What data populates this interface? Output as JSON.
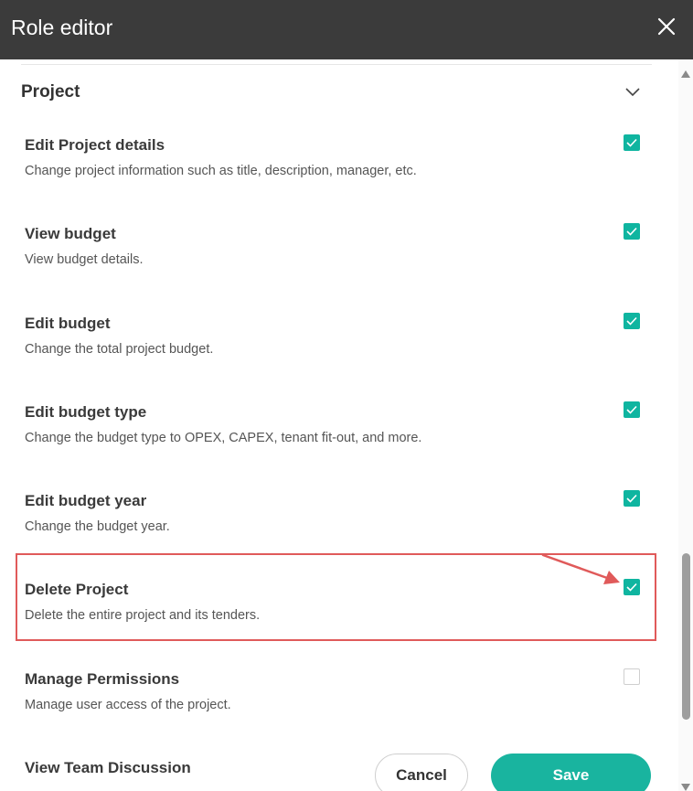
{
  "header": {
    "title": "Role editor"
  },
  "section": {
    "title": "Project"
  },
  "permissions": [
    {
      "title": "Edit Project details",
      "description": "Change project information such as title, description, manager, etc.",
      "checked": true
    },
    {
      "title": "View budget",
      "description": "View budget details.",
      "checked": true
    },
    {
      "title": "Edit budget",
      "description": "Change the total project budget.",
      "checked": true
    },
    {
      "title": "Edit budget type",
      "description": "Change the budget type to OPEX, CAPEX, tenant fit-out, and more.",
      "checked": true
    },
    {
      "title": "Edit budget year",
      "description": "Change the budget year.",
      "checked": true
    },
    {
      "title": "Delete Project",
      "description": "Delete the entire project and its tenders.",
      "checked": true
    },
    {
      "title": "Manage Permissions",
      "description": "Manage user access of the project.",
      "checked": false
    },
    {
      "title": "View Team Discussion",
      "description": "",
      "checked": false
    }
  ],
  "footer": {
    "cancel_label": "Cancel",
    "save_label": "Save"
  },
  "colors": {
    "header_bg": "#3b3b3b",
    "accent": "#19b49f",
    "checkbox": "#0fb5a0",
    "highlight": "#e05a5a"
  }
}
